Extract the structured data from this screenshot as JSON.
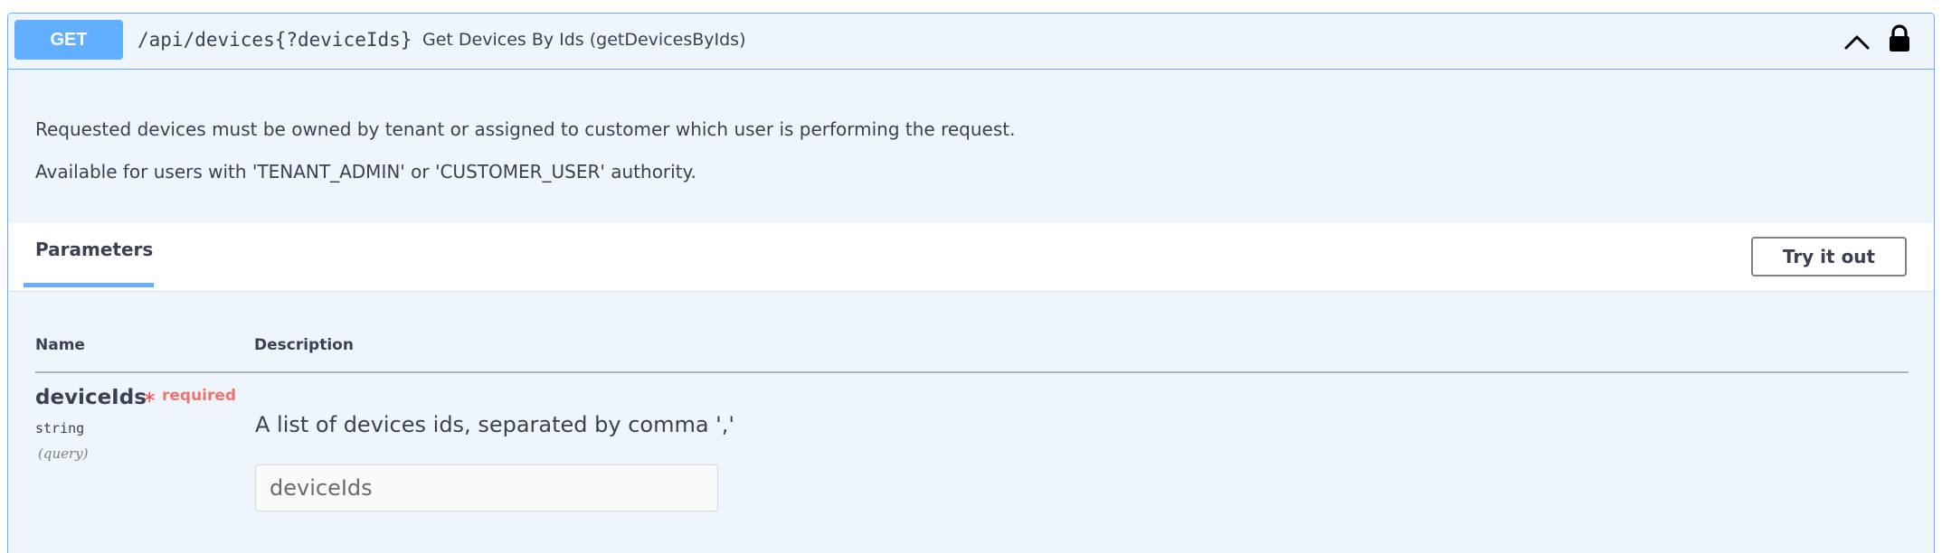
{
  "summary": {
    "method": "GET",
    "path": "/api/devices{?deviceIds}",
    "description": "Get Devices By Ids (getDevicesByIds)"
  },
  "description": {
    "line1": "Requested devices must be owned by tenant or assigned to customer which user is performing the request.",
    "line2": "Available for users with 'TENANT_ADMIN' or 'CUSTOMER_USER' authority."
  },
  "parameters": {
    "tab_label": "Parameters",
    "try_button": "Try it out",
    "col_name": "Name",
    "col_description": "Description",
    "rows": [
      {
        "name": "deviceIds",
        "required_star": "*",
        "required_label": "required",
        "type": "string",
        "in": "(query)",
        "description": "A list of devices ids, separated by comma ','",
        "placeholder": "deviceIds"
      }
    ]
  },
  "colors": {
    "method_get": "#61affe",
    "block_background": "#eef5fd",
    "required_star": "#f93e3e",
    "required_label": "#f1736e"
  },
  "icons": {
    "collapse": "chevron-up-icon",
    "auth": "lock-icon"
  }
}
